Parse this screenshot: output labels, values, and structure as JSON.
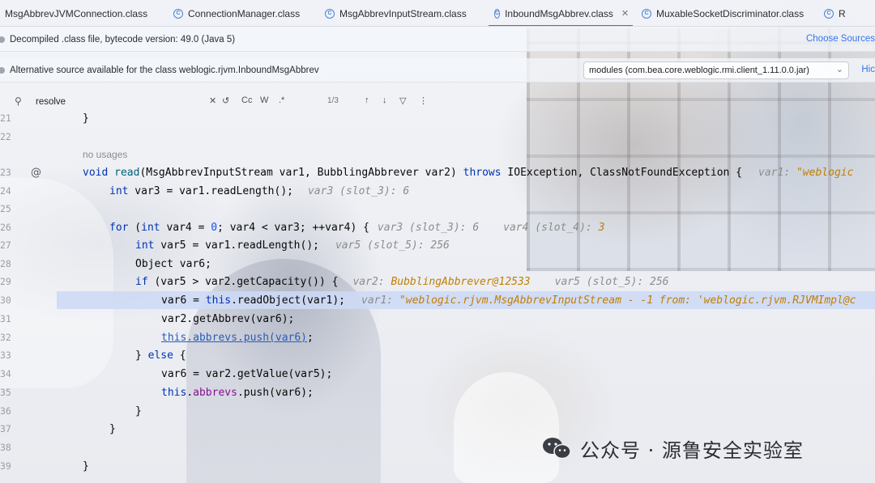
{
  "tabs": [
    {
      "label": "MsgAbbrevJVMConnection.class",
      "active": false,
      "closable": false
    },
    {
      "label": "ConnectionManager.class",
      "active": false,
      "closable": false
    },
    {
      "label": "MsgAbbrevInputStream.class",
      "active": false,
      "closable": false
    },
    {
      "label": "InboundMsgAbbrev.class",
      "active": true,
      "closable": true
    },
    {
      "label": "MuxableSocketDiscriminator.class",
      "active": false,
      "closable": false
    },
    {
      "label": "R",
      "active": false,
      "closable": false
    }
  ],
  "banner1": {
    "text": "Decompiled .class file, bytecode version: 49.0 (Java 5)",
    "action": "Choose Sources"
  },
  "banner2": {
    "text": "Alternative source available for the class weblogic.rjvm.InboundMsgAbbrev",
    "module_select": "modules (com.bea.core.weblogic.rmi.client_1.11.0.0.jar)",
    "action": "Hic"
  },
  "search": {
    "query": "resolve",
    "match_case": "Cc",
    "words": "W",
    "regex": ".*",
    "count": "1/3"
  },
  "editor": {
    "lines": {
      "n21": "21",
      "n22": "22",
      "n23": "23",
      "n24": "24",
      "n25": "25",
      "n26": "26",
      "n27": "27",
      "n28": "28",
      "n29": "29",
      "n30": "30",
      "n31": "31",
      "n32": "32",
      "n33": "33",
      "n34": "34",
      "n35": "35",
      "n36": "36",
      "n37": "37",
      "n38": "38",
      "n39": "39"
    },
    "usages": "no usages",
    "code": {
      "l21": "}",
      "l23_void": "void ",
      "l23_name": "read",
      "l23_params": "(MsgAbbrevInputStream var1, BubblingAbbrever var2) ",
      "l23_throws": "throws",
      "l23_exc": " IOException, ClassNotFoundException {",
      "l23_hint_name": "var1: ",
      "l23_hint_val": "\"weblogic",
      "l24_int": "int",
      "l24_rest": " var3 = var1.readLength();",
      "l24_hint": "var3 (slot_3): 6",
      "l26_for": "for",
      "l26_paren": " (",
      "l26_int": "int",
      "l26_a": " var4 = ",
      "l26_zero": "0",
      "l26_b": "; var4 < var3; ++var4) {",
      "l26_hint1": "var3 (slot_3): 6",
      "l26_hint2": "var4 (slot_4): ",
      "l26_hint2_val": "3",
      "l27_int": "int",
      "l27_rest": " var5 = var1.readLength();",
      "l27_hint": "var5 (slot_5): 256",
      "l28": "Object var6;",
      "l29_if": "if",
      "l29_rest": " (var5 > var2.getCapacity()) {",
      "l29_hint1": "var2: ",
      "l29_hint1_val": "BubblingAbbrever@12533",
      "l29_hint2": "var5 (slot_5): 256",
      "l30_a": "var6 = ",
      "l30_this": "this",
      "l30_b": ".readObject(var1);",
      "l30_hint": "var1: ",
      "l30_hint_val": "\"weblogic.rjvm.MsgAbbrevInputStream - -1 from: 'weblogic.rjvm.RJVMImpl@c",
      "l31": "var2.getAbbrev(var6);",
      "l32": "this.abbrevs.push(var6)",
      "l32_semi": ";",
      "l33_close": "} ",
      "l33_else": "else",
      "l33_brace": " {",
      "l34": "var6 = var2.getValue(var5);",
      "l35_this": "this",
      "l35_dot": ".",
      "l35_field": "abbrevs",
      "l35_rest": ".push(var6);",
      "l36": "}",
      "l37": "}",
      "l39": "}"
    }
  },
  "watermark": "公众号 · 源鲁安全实验室",
  "colors": {
    "keyword": "#0033b3",
    "number": "#1750eb",
    "field": "#871094",
    "hint": "#8c8c8c",
    "hint_value": "#c17e00",
    "accent": "#3574f0",
    "highlight": "#cddaf5"
  }
}
